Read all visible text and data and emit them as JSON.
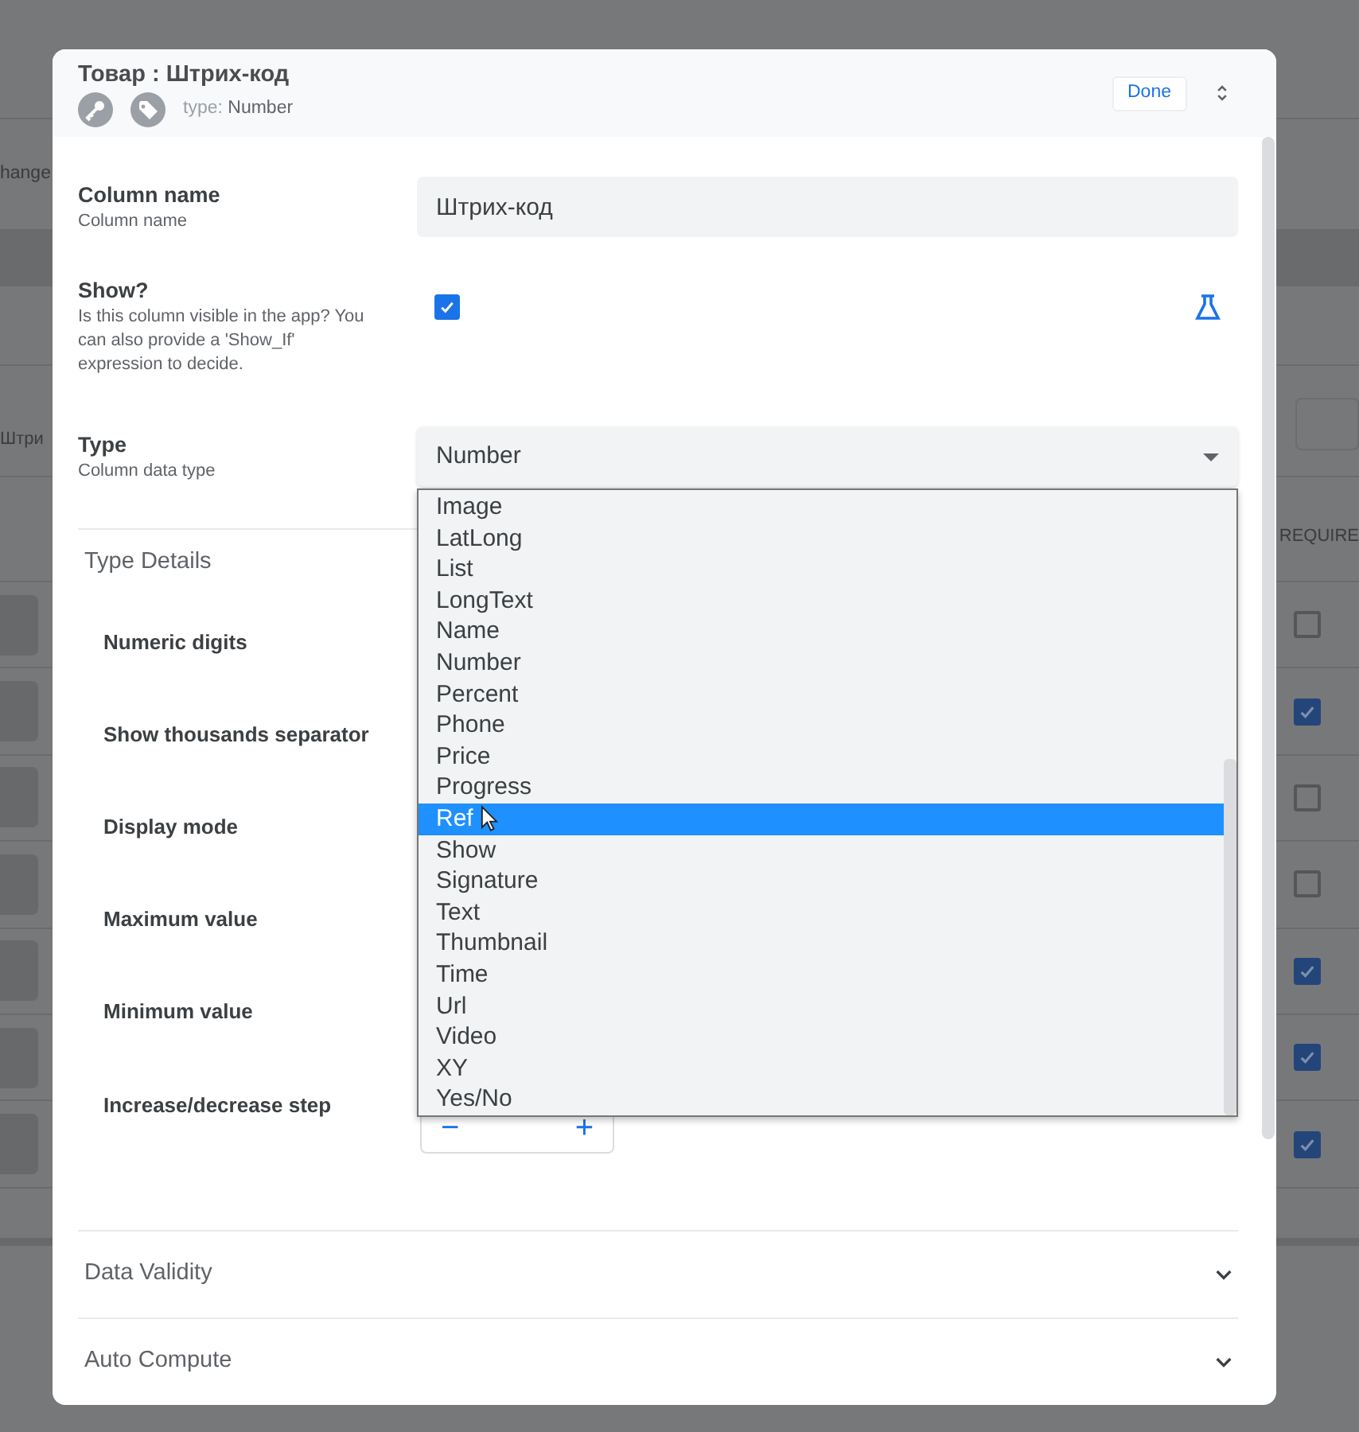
{
  "background": {
    "texts": [
      "hange",
      "Штри"
    ],
    "column_header": "REQUIRE",
    "required": [
      {
        "checked": false
      },
      {
        "checked": true
      },
      {
        "checked": false
      },
      {
        "checked": false
      },
      {
        "checked": true
      },
      {
        "checked": true
      },
      {
        "checked": true
      }
    ]
  },
  "dialog": {
    "title": "Товар : Штрих-код",
    "type_label": "type:",
    "type_value": "Number",
    "done": "Done",
    "fields": [
      {
        "kind": "text",
        "label": "Column name",
        "hint": "Column name",
        "value": "Штрих-код"
      },
      {
        "kind": "checkbox",
        "label": "Show?",
        "hint": "Is this column visible in the app? You can also provide a 'Show_If' expression to decide.",
        "checked": true
      },
      {
        "kind": "select",
        "label": "Type",
        "hint": "Column data type",
        "value": "Number",
        "expanded": true
      }
    ],
    "type_details": {
      "title": "Type Details",
      "rows": [
        "Numeric digits",
        "Show thousands separator",
        "Display mode",
        "Maximum value",
        "Minimum value",
        "Increase/decrease step"
      ]
    },
    "stepper": {
      "minus": "−",
      "plus": "+"
    },
    "sections": [
      {
        "title": "Data Validity",
        "expanded": false
      },
      {
        "title": "Auto Compute",
        "expanded": false
      }
    ],
    "dropdown_options": [
      {
        "label": "Image",
        "selected": false
      },
      {
        "label": "LatLong",
        "selected": false
      },
      {
        "label": "List",
        "selected": false
      },
      {
        "label": "LongText",
        "selected": false
      },
      {
        "label": "Name",
        "selected": false
      },
      {
        "label": "Number",
        "selected": false
      },
      {
        "label": "Percent",
        "selected": false
      },
      {
        "label": "Phone",
        "selected": false
      },
      {
        "label": "Price",
        "selected": false
      },
      {
        "label": "Progress",
        "selected": false
      },
      {
        "label": "Ref",
        "selected": true
      },
      {
        "label": "Show",
        "selected": false
      },
      {
        "label": "Signature",
        "selected": false
      },
      {
        "label": "Text",
        "selected": false
      },
      {
        "label": "Thumbnail",
        "selected": false
      },
      {
        "label": "Time",
        "selected": false
      },
      {
        "label": "Url",
        "selected": false
      },
      {
        "label": "Video",
        "selected": false
      },
      {
        "label": "XY",
        "selected": false
      },
      {
        "label": "Yes/No",
        "selected": false
      }
    ]
  }
}
